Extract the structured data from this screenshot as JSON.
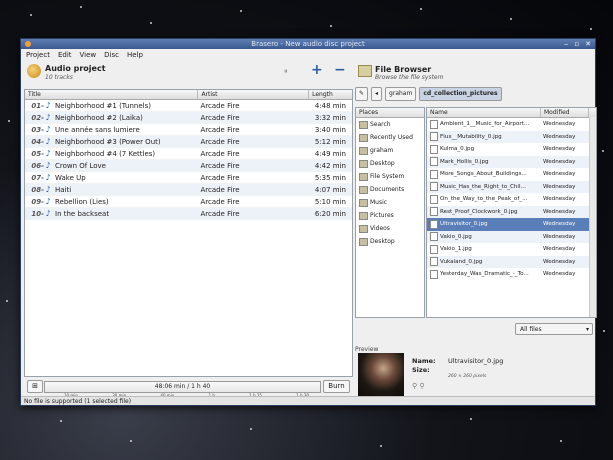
{
  "window": {
    "title": "Brasero - New audio disc project"
  },
  "menu": [
    "Project",
    "Edit",
    "View",
    "Disc",
    "Help"
  ],
  "project": {
    "title": "Audio project",
    "subtitle": "10 tracks"
  },
  "track_table": {
    "columns": [
      "Title",
      "Artist",
      "Length"
    ],
    "rows": [
      {
        "num": "01-",
        "title": "Neighborhood #1 (Tunnels)",
        "artist": "Arcade Fire",
        "length": "4:48 min"
      },
      {
        "num": "02-",
        "title": "Neighborhood #2 (Laika)",
        "artist": "Arcade Fire",
        "length": "3:32 min"
      },
      {
        "num": "03-",
        "title": "Une année sans lumiere",
        "artist": "Arcade Fire",
        "length": "3:40 min"
      },
      {
        "num": "04-",
        "title": "Neighborhood #3 (Power Out)",
        "artist": "Arcade Fire",
        "length": "5:12 min"
      },
      {
        "num": "05-",
        "title": "Neighborhood #4 (7 Kettles)",
        "artist": "Arcade Fire",
        "length": "4:49 min"
      },
      {
        "num": "06-",
        "title": "Crown Of Love",
        "artist": "Arcade Fire",
        "length": "4:42 min"
      },
      {
        "num": "07-",
        "title": "Wake Up",
        "artist": "Arcade Fire",
        "length": "5:35 min"
      },
      {
        "num": "08-",
        "title": "Haiti",
        "artist": "Arcade Fire",
        "length": "4:07 min"
      },
      {
        "num": "09-",
        "title": "Rebellion (Lies)",
        "artist": "Arcade Fire",
        "length": "5:10 min"
      },
      {
        "num": "10-",
        "title": "In the backseat",
        "artist": "Arcade Fire",
        "length": "6:20 min"
      }
    ]
  },
  "bottom": {
    "total": "48:06 min / 1 h 40",
    "scale": [
      "10 min",
      "30 min",
      "40 min",
      "1 h",
      "1 h 15",
      "1 h 30"
    ],
    "burn_label": "Burn"
  },
  "file_browser": {
    "title": "File Browser",
    "subtitle": "Browse the file system",
    "path": [
      "graham",
      "cd_collection_pictures"
    ],
    "places_header": "Places",
    "places": [
      "Search",
      "Recently Used",
      "graham",
      "Desktop",
      "File System",
      "Documents",
      "Music",
      "Pictures",
      "Videos",
      "Desktop"
    ],
    "columns": [
      "Name",
      "Modified"
    ],
    "files": [
      {
        "name": "Ambient_1__Music_for_Airport...",
        "modified": "Wednesday"
      },
      {
        "name": "Flux__Mutability_0.jpg",
        "modified": "Wednesday"
      },
      {
        "name": "Kulma_0.jpg",
        "modified": "Wednesday"
      },
      {
        "name": "Mark_Hollis_0.jpg",
        "modified": "Wednesday"
      },
      {
        "name": "More_Songs_About_Buildings...",
        "modified": "Wednesday"
      },
      {
        "name": "Music_Has_the_Right_to_Chil...",
        "modified": "Wednesday"
      },
      {
        "name": "On_the_Way_to_the_Peak_of_...",
        "modified": "Wednesday"
      },
      {
        "name": "Rest_Proof_Clockwork_0.jpg",
        "modified": "Wednesday"
      },
      {
        "name": "Ultravisitor_0.jpg",
        "modified": "Wednesday"
      },
      {
        "name": "Vakio_0.jpg",
        "modified": "Wednesday"
      },
      {
        "name": "Vakio_1.jpg",
        "modified": "Wednesday"
      },
      {
        "name": "Vukaland_0.jpg",
        "modified": "Wednesday"
      },
      {
        "name": "Yesterday_Was_Dramatic_-_To...",
        "modified": "Wednesday"
      }
    ],
    "selected_index": 8,
    "filter": "All files",
    "preview": {
      "label": "Preview",
      "name_key": "Name:",
      "name_val": "Ultravisitor_0.jpg",
      "size_key": "Size:",
      "size_val": "260 × 260 pixels"
    }
  },
  "status": "No file is supported (1 selected file)"
}
